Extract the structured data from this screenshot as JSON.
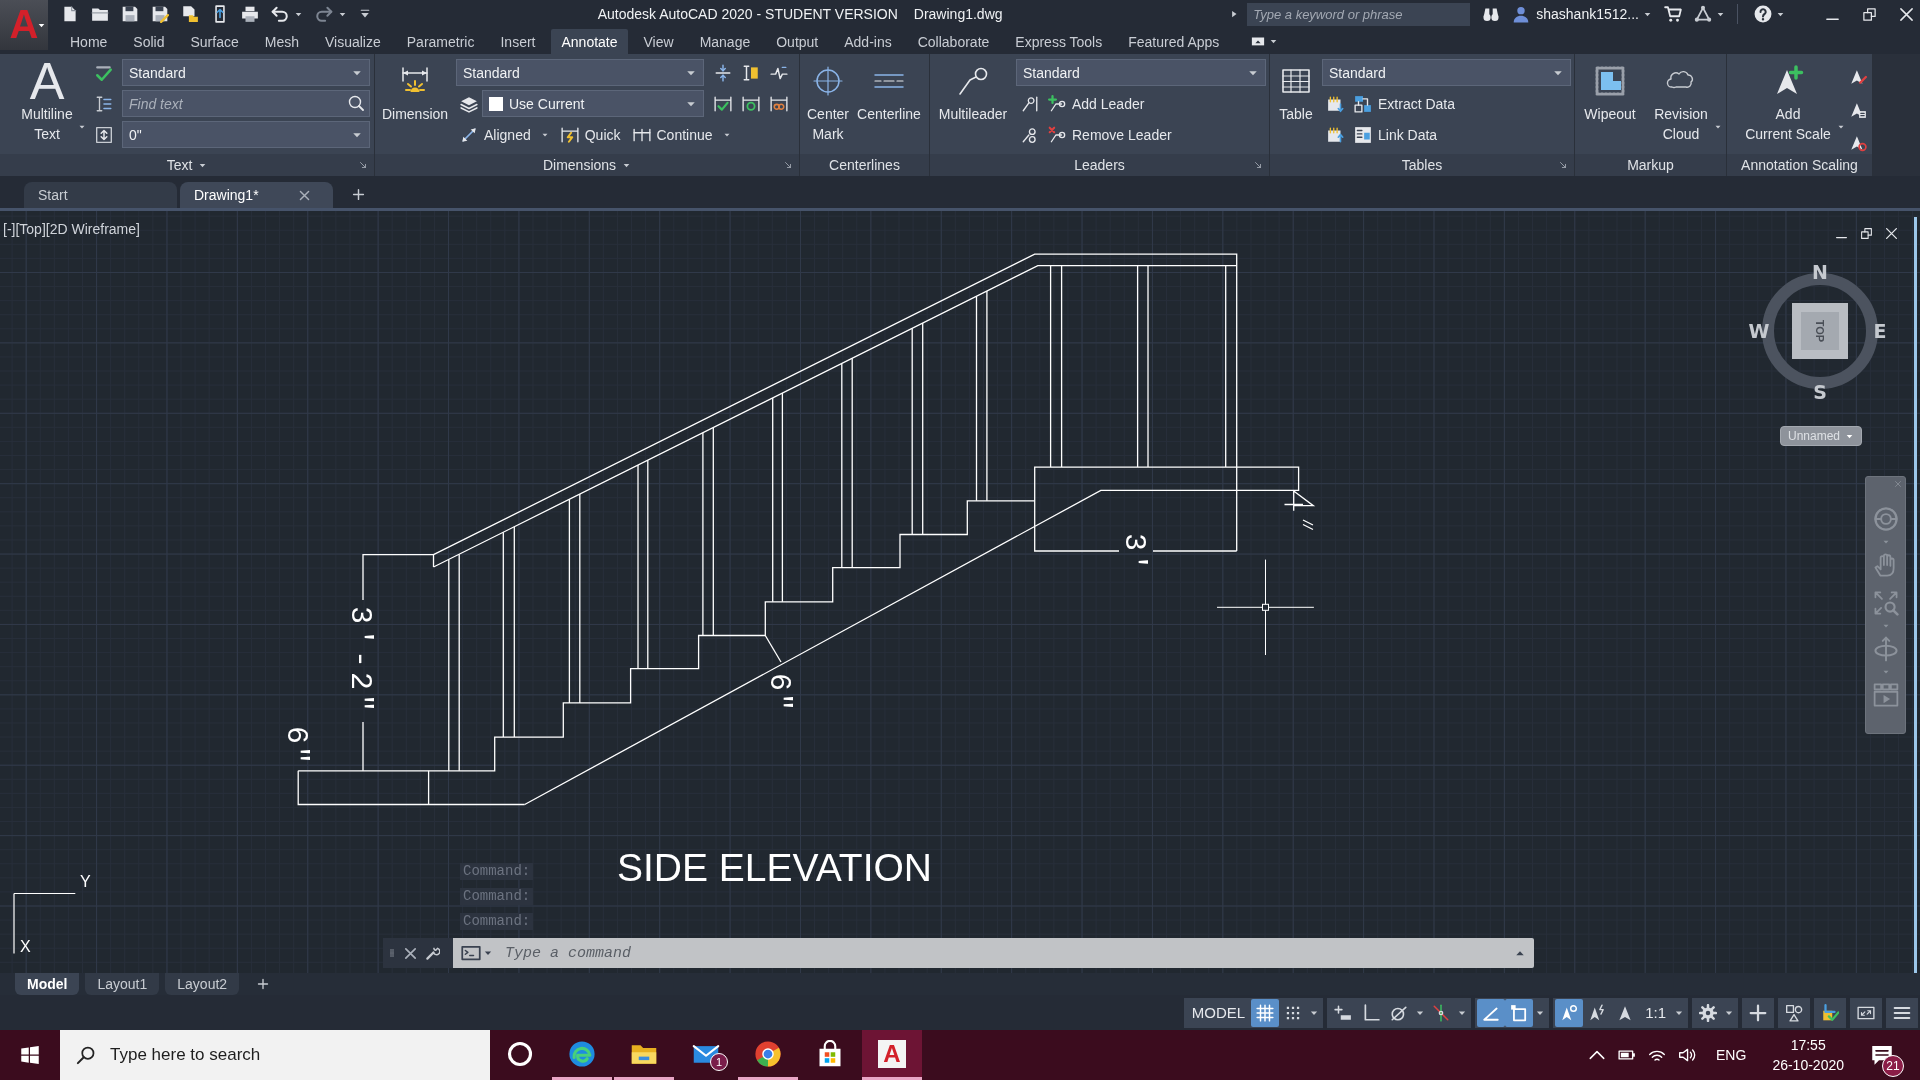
{
  "app_button": {
    "glyph": "A"
  },
  "title_bar": {
    "title": "Autodesk AutoCAD 2020 - STUDENT VERSION",
    "file_name": "Drawing1.dwg",
    "search": {
      "placeholder": "Type a keyword or phrase"
    },
    "user_name": "shashank1512..."
  },
  "ribbon_tabs": [
    {
      "label": "Home",
      "selected": false
    },
    {
      "label": "Solid",
      "selected": false
    },
    {
      "label": "Surface",
      "selected": false
    },
    {
      "label": "Mesh",
      "selected": false
    },
    {
      "label": "Visualize",
      "selected": false
    },
    {
      "label": "Parametric",
      "selected": false
    },
    {
      "label": "Insert",
      "selected": false
    },
    {
      "label": "Annotate",
      "selected": true
    },
    {
      "label": "View",
      "selected": false
    },
    {
      "label": "Manage",
      "selected": false
    },
    {
      "label": "Output",
      "selected": false
    },
    {
      "label": "Add-ins",
      "selected": false
    },
    {
      "label": "Collaborate",
      "selected": false
    },
    {
      "label": "Express Tools",
      "selected": false
    },
    {
      "label": "Featured Apps",
      "selected": false
    }
  ],
  "ribbon": {
    "text_panel": {
      "title": "Text",
      "menu": true,
      "launcher": true,
      "multiline_text": {
        "glyph": "A",
        "lines": [
          "Multiline",
          "Text"
        ],
        "dropdown": true
      },
      "style": "Standard",
      "find_text": {
        "placeholder": "Find text"
      },
      "text_height": "0\""
    },
    "dimensions_panel": {
      "title": "Dimensions",
      "menu": true,
      "launcher": true,
      "dimension": "Dimension",
      "style": "Standard",
      "layer": "Use Current",
      "tools": [
        {
          "kind": "aligned",
          "label": "Aligned",
          "dropdown": true
        },
        {
          "kind": "quick",
          "label": "Quick",
          "dropdown": false
        },
        {
          "kind": "continue",
          "label": "Continue",
          "dropdown": true
        }
      ]
    },
    "centerlines_panel": {
      "title": "Centerlines",
      "menu": false,
      "launcher": false,
      "buttons": [
        {
          "kind": "center-mark",
          "lines": [
            "Center",
            "Mark"
          ],
          "dropdown": false
        },
        {
          "kind": "centerline",
          "lines": [
            "Centerline"
          ],
          "dropdown": false
        }
      ]
    },
    "leaders_panel": {
      "title": "Leaders",
      "menu": false,
      "launcher": true,
      "multileader": "Multileader",
      "style": "Standard",
      "actions": [
        {
          "kind": "add",
          "label": "Add Leader"
        },
        {
          "kind": "remove",
          "label": "Remove Leader"
        }
      ]
    },
    "tables_panel": {
      "title": "Tables",
      "menu": false,
      "launcher": true,
      "table": "Table",
      "style": "Standard",
      "actions": [
        {
          "kind": "extract",
          "label": "Extract Data"
        },
        {
          "kind": "link",
          "label": "Link Data"
        }
      ]
    },
    "markup_panel": {
      "title": "Markup",
      "menu": false,
      "launcher": false,
      "buttons": [
        {
          "kind": "wipeout",
          "lines": [
            "Wipeout"
          ],
          "dropdown": false
        },
        {
          "kind": "revision-cloud",
          "lines": [
            "Revision",
            "Cloud"
          ],
          "dropdown": true
        }
      ]
    },
    "annotation_scaling_panel": {
      "title": "Annotation Scaling",
      "menu": false,
      "launcher": false,
      "add_scale": {
        "lines": [
          "Add",
          "Current Scale"
        ],
        "dropdown": true
      }
    }
  },
  "file_tabs": [
    {
      "label": "Start",
      "selected": false
    },
    {
      "label": "Drawing1*",
      "selected": true
    }
  ],
  "viewport": {
    "label": "[-][Top][2D Wireframe]",
    "compass": {
      "north": "N",
      "east": "E",
      "south": "S",
      "west": "W",
      "face": "TOP"
    },
    "view_name": "Unnamed",
    "dimension_texts": [
      "3'-2\"",
      "6\"",
      "6\"",
      "3'"
    ],
    "drawing_title": "SIDE ELEVATION",
    "ucs": {
      "x": "X",
      "y": "Y"
    }
  },
  "command_line": {
    "history": [
      "Command:",
      "Command:",
      "Command:"
    ],
    "placeholder": "Type a command"
  },
  "layout_tabs": [
    {
      "label": "Model",
      "selected": true
    },
    {
      "label": "Layout1",
      "selected": false
    },
    {
      "label": "Layout2",
      "selected": false
    }
  ],
  "status_bar": {
    "groups": [
      [
        {
          "kind": "space",
          "label": "MODEL",
          "on": false,
          "dropdown": false
        },
        {
          "kind": "grid",
          "on": true,
          "dropdown": false
        },
        {
          "kind": "snap",
          "on": false,
          "dropdown": true
        }
      ],
      [
        {
          "kind": "dynamic-input",
          "on": false,
          "dropdown": false
        },
        {
          "kind": "ortho",
          "on": false,
          "dropdown": false
        },
        {
          "kind": "polar",
          "on": false,
          "dropdown": true
        },
        {
          "kind": "tracking",
          "on": false,
          "dropdown": true
        }
      ],
      [
        {
          "kind": "isodraft",
          "on": true,
          "dropdown": false
        },
        {
          "kind": "object-snap",
          "on": true,
          "dropdown": true
        }
      ],
      [
        {
          "kind": "annotation-visibility",
          "on": true,
          "dropdown": false
        },
        {
          "kind": "autoscale",
          "on": false,
          "dropdown": false
        },
        {
          "kind": "annotation-scale",
          "on": false,
          "dropdown": false
        },
        {
          "kind": "scale",
          "label": "1:1",
          "on": false,
          "dropdown": true
        }
      ],
      [
        {
          "kind": "workspace",
          "on": false,
          "dropdown": true
        }
      ],
      [
        {
          "kind": "annotation-monitor",
          "on": false,
          "dropdown": false
        }
      ],
      [
        {
          "kind": "isolate",
          "on": false,
          "dropdown": false
        }
      ],
      [
        {
          "kind": "hardware",
          "on": false,
          "dropdown": false
        }
      ],
      [
        {
          "kind": "clean-screen",
          "on": false,
          "dropdown": false
        }
      ],
      [
        {
          "kind": "customize",
          "on": false,
          "dropdown": false
        }
      ]
    ]
  },
  "taskbar": {
    "search": {
      "placeholder": "Type here to search"
    },
    "apps": [
      {
        "kind": "cortana",
        "running": false,
        "selected": false
      },
      {
        "kind": "edge",
        "running": true,
        "selected": false
      },
      {
        "kind": "explorer",
        "running": true,
        "selected": false
      },
      {
        "kind": "mail",
        "running": false,
        "selected": false,
        "badge": "1"
      },
      {
        "kind": "chrome",
        "running": true,
        "selected": false
      },
      {
        "kind": "store",
        "running": false,
        "selected": false
      },
      {
        "kind": "autocad",
        "running": true,
        "selected": true,
        "glyph": "A"
      }
    ],
    "tray": {
      "language": "ENG",
      "time": "17:55",
      "date": "26-10-2020",
      "notifications": "21"
    }
  }
}
